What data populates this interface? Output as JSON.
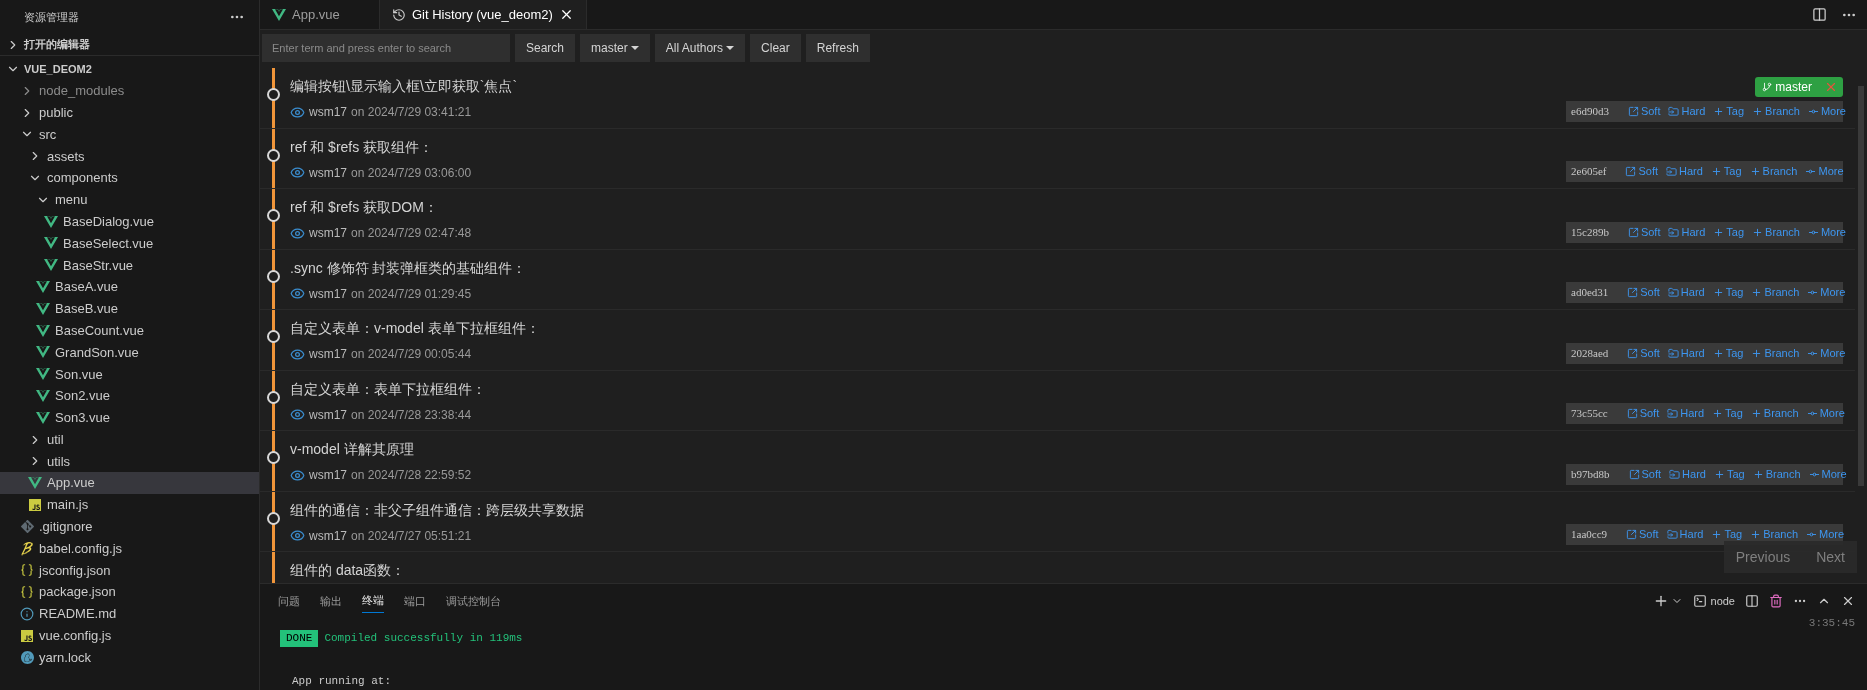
{
  "sidebar": {
    "title": "资源管理器",
    "open_editors": {
      "label": "打开的编辑器",
      "expanded": false
    },
    "project": {
      "label": "VUE_DEOM2",
      "expanded": true
    },
    "tree": [
      {
        "label": "node_modules",
        "kind": "folder",
        "expanded": false,
        "dimmed": true,
        "selected": false
      },
      {
        "label": "public",
        "kind": "folder",
        "expanded": false,
        "dimmed": false,
        "selected": false
      },
      {
        "label": "src",
        "kind": "folder",
        "expanded": true,
        "dimmed": false,
        "selected": false,
        "children": [
          {
            "label": "assets",
            "kind": "folder",
            "expanded": false,
            "dimmed": false,
            "selected": false
          },
          {
            "label": "components",
            "kind": "folder",
            "expanded": true,
            "dimmed": false,
            "selected": false,
            "children": [
              {
                "label": "menu",
                "kind": "folder",
                "expanded": true,
                "dimmed": false,
                "selected": false,
                "children": [
                  {
                    "label": "BaseDialog.vue",
                    "kind": "vue",
                    "dimmed": false,
                    "selected": false
                  },
                  {
                    "label": "BaseSelect.vue",
                    "kind": "vue",
                    "dimmed": false,
                    "selected": false
                  },
                  {
                    "label": "BaseStr.vue",
                    "kind": "vue",
                    "dimmed": false,
                    "selected": false
                  }
                ]
              },
              {
                "label": "BaseA.vue",
                "kind": "vue",
                "dimmed": false,
                "selected": false
              },
              {
                "label": "BaseB.vue",
                "kind": "vue",
                "dimmed": false,
                "selected": false
              },
              {
                "label": "BaseCount.vue",
                "kind": "vue",
                "dimmed": false,
                "selected": false
              },
              {
                "label": "GrandSon.vue",
                "kind": "vue",
                "dimmed": false,
                "selected": false
              },
              {
                "label": "Son.vue",
                "kind": "vue",
                "dimmed": false,
                "selected": false
              },
              {
                "label": "Son2.vue",
                "kind": "vue",
                "dimmed": false,
                "selected": false
              },
              {
                "label": "Son3.vue",
                "kind": "vue",
                "dimmed": false,
                "selected": false
              }
            ]
          },
          {
            "label": "util",
            "kind": "folder",
            "expanded": false,
            "dimmed": false,
            "selected": false
          },
          {
            "label": "utils",
            "kind": "folder",
            "expanded": false,
            "dimmed": false,
            "selected": false
          },
          {
            "label": "App.vue",
            "kind": "vue",
            "dimmed": false,
            "selected": true
          },
          {
            "label": "main.js",
            "kind": "js",
            "dimmed": false,
            "selected": false
          }
        ]
      },
      {
        "label": ".gitignore",
        "kind": "git",
        "dimmed": false,
        "selected": false
      },
      {
        "label": "babel.config.js",
        "kind": "babel",
        "dimmed": false,
        "selected": false
      },
      {
        "label": "jsconfig.json",
        "kind": "json",
        "dimmed": false,
        "selected": false
      },
      {
        "label": "package.json",
        "kind": "json",
        "dimmed": false,
        "selected": false
      },
      {
        "label": "README.md",
        "kind": "info",
        "dimmed": false,
        "selected": false
      },
      {
        "label": "vue.config.js",
        "kind": "js",
        "dimmed": false,
        "selected": false
      },
      {
        "label": "yarn.lock",
        "kind": "yarn",
        "dimmed": false,
        "selected": false
      }
    ]
  },
  "editor_tabs": [
    {
      "label": "App.vue",
      "kind": "vue",
      "selected": false,
      "closable": false
    },
    {
      "label": "Git History (vue_deom2)",
      "kind": "history",
      "selected": true,
      "closable": true
    }
  ],
  "toolbar": {
    "search": {
      "placeholder": "Enter term and press enter to search"
    },
    "buttons": [
      {
        "label": "Search",
        "dropdown": false
      },
      {
        "label": "master",
        "dropdown": true
      },
      {
        "label": "All Authors",
        "dropdown": true
      },
      {
        "label": "Clear",
        "dropdown": false
      },
      {
        "label": "Refresh",
        "dropdown": false
      }
    ]
  },
  "commits": [
    {
      "message": "编辑按钮\\显示输入框\\立即获取`焦点`",
      "author": "wsm17",
      "on": "on",
      "date": "2024/7/29 03:41:21",
      "hash": "e6d90d3",
      "branches": [
        "master"
      ],
      "actions": [
        "Soft",
        "Hard",
        "Tag",
        "Branch",
        "More"
      ]
    },
    {
      "message": "ref 和 $refs 获取组件：",
      "author": "wsm17",
      "on": "on",
      "date": "2024/7/29 03:06:00",
      "hash": "2e605ef",
      "actions": [
        "Soft",
        "Hard",
        "Tag",
        "Branch",
        "More"
      ]
    },
    {
      "message": "ref 和 $refs 获取DOM：",
      "author": "wsm17",
      "on": "on",
      "date": "2024/7/29 02:47:48",
      "hash": "15c289b",
      "actions": [
        "Soft",
        "Hard",
        "Tag",
        "Branch",
        "More"
      ]
    },
    {
      "message": ".sync 修饰符 封装弹框类的基础组件：",
      "author": "wsm17",
      "on": "on",
      "date": "2024/7/29 01:29:45",
      "hash": "ad0ed31",
      "actions": [
        "Soft",
        "Hard",
        "Tag",
        "Branch",
        "More"
      ]
    },
    {
      "message": "自定义表单：v-model 表单下拉框组件：",
      "author": "wsm17",
      "on": "on",
      "date": "2024/7/29 00:05:44",
      "hash": "2028aed",
      "actions": [
        "Soft",
        "Hard",
        "Tag",
        "Branch",
        "More"
      ]
    },
    {
      "message": "自定义表单：表单下拉框组件：",
      "author": "wsm17",
      "on": "on",
      "date": "2024/7/28 23:38:44",
      "hash": "73c55cc",
      "actions": [
        "Soft",
        "Hard",
        "Tag",
        "Branch",
        "More"
      ]
    },
    {
      "message": "v-model 详解其原理",
      "author": "wsm17",
      "on": "on",
      "date": "2024/7/28 22:59:52",
      "hash": "b97bd8b",
      "actions": [
        "Soft",
        "Hard",
        "Tag",
        "Branch",
        "More"
      ]
    },
    {
      "message": "组件的通信：非父子组件通信：跨层级共享数据",
      "author": "wsm17",
      "on": "on",
      "date": "2024/7/27 05:51:21",
      "hash": "1aa0cc9",
      "actions": [
        "Soft",
        "Hard",
        "Tag",
        "Branch",
        "More"
      ]
    },
    {
      "message": "组件的 data函数："
    }
  ],
  "pager": [
    "Previous",
    "Next"
  ],
  "panel": {
    "tabs": [
      {
        "label": "问题",
        "selected": false
      },
      {
        "label": "输出",
        "selected": false
      },
      {
        "label": "终端",
        "selected": true
      },
      {
        "label": "端口",
        "selected": false
      },
      {
        "label": "调试控制台",
        "selected": false
      }
    ],
    "terminal_name": "node",
    "time": "3:35:45",
    "lines": [
      {
        "badge": "DONE",
        "text": "Compiled successfully in 119ms"
      },
      {
        "text": "App running at:"
      }
    ]
  }
}
